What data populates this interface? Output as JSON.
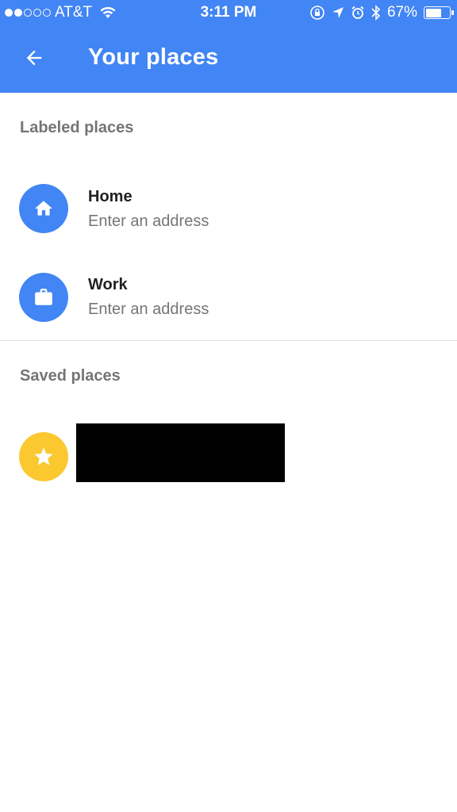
{
  "status_bar": {
    "carrier": "AT&T",
    "signal_bars_filled": 2,
    "signal_bars_total": 5,
    "time": "3:11 PM",
    "battery": "67%",
    "battery_level": 0.67
  },
  "header": {
    "title": "Your places",
    "background_color": "#4285f4"
  },
  "labeled_section": {
    "heading": "Labeled places",
    "items": [
      {
        "name": "Home",
        "subtitle": "Enter an address",
        "icon": "home-icon",
        "color": "#4285f4"
      },
      {
        "name": "Work",
        "subtitle": "Enter an address",
        "icon": "briefcase-icon",
        "color": "#4285f4"
      }
    ]
  },
  "saved_section": {
    "heading": "Saved places",
    "items": [
      {
        "icon": "star-icon",
        "color": "#fbc830"
      }
    ]
  }
}
